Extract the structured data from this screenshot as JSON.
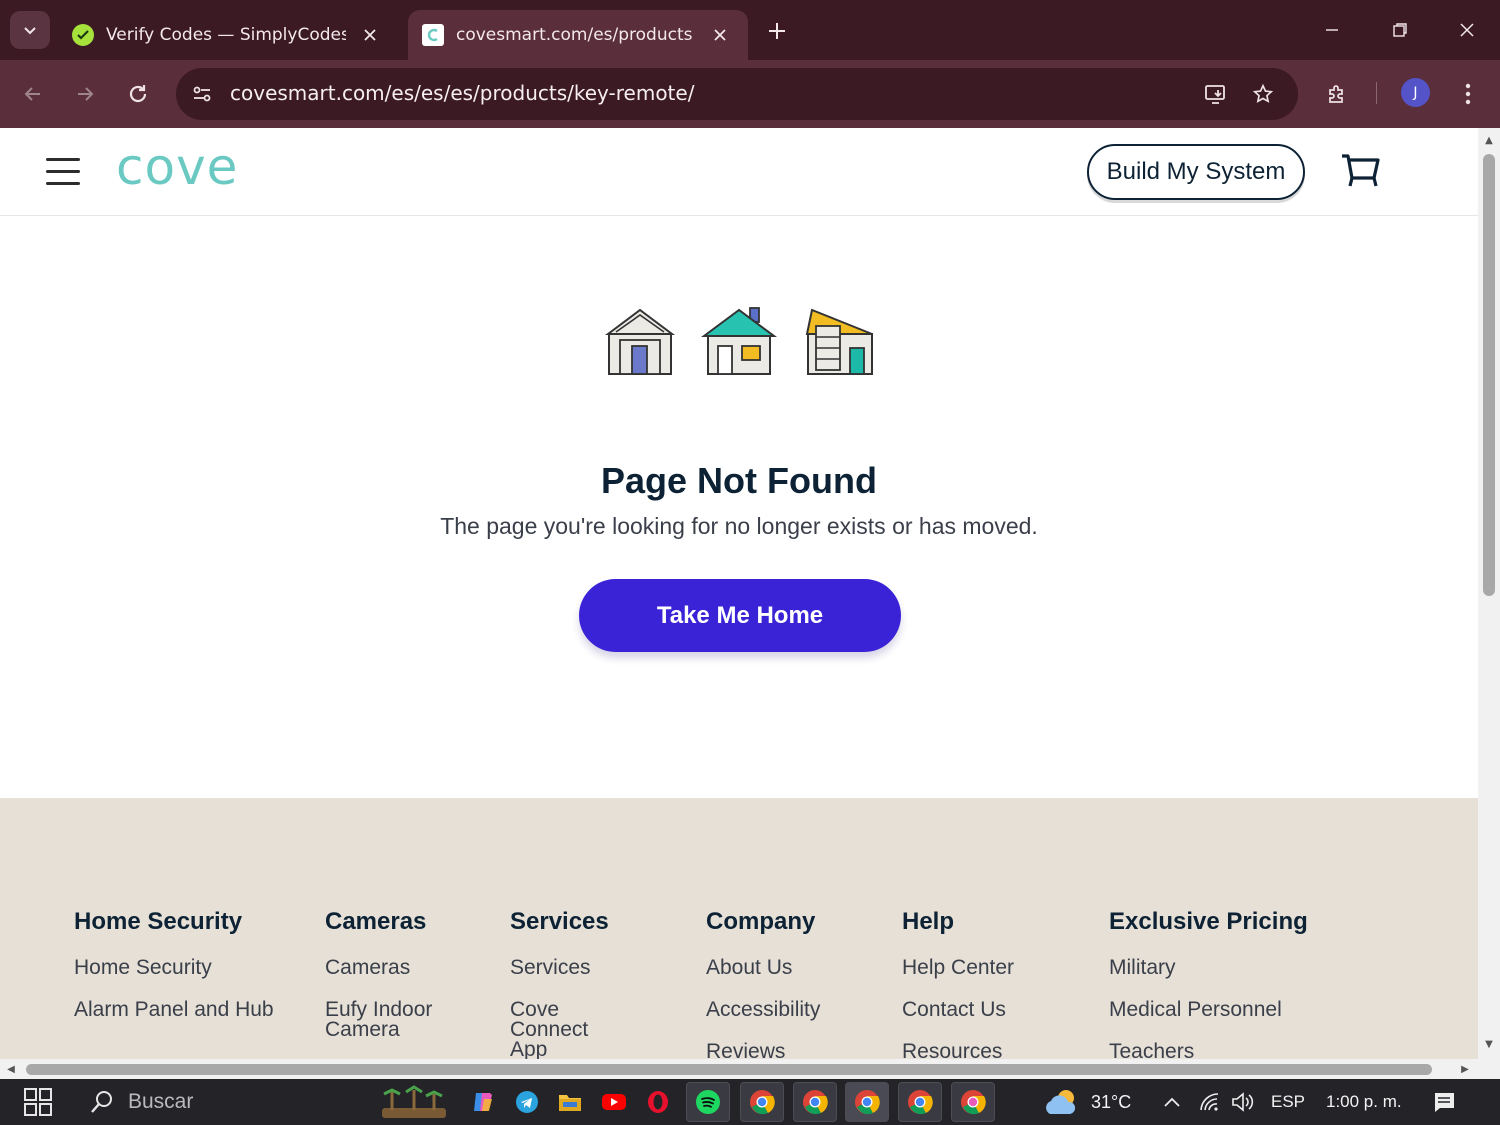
{
  "browser": {
    "tabs": [
      {
        "title": "Verify Codes — SimplyCodes",
        "active": false
      },
      {
        "title": "covesmart.com/es/products/key-remote/",
        "active": true
      }
    ],
    "url": "covesmart.com/es/es/es/products/key-remote/",
    "profile_initial": "J"
  },
  "site": {
    "logo": "cove",
    "build_button": "Build My System"
  },
  "not_found": {
    "title": "Page Not Found",
    "subtitle": "The page you're looking for no longer exists or has moved.",
    "home_button": "Take Me Home"
  },
  "footer": {
    "columns": [
      {
        "heading": "Home Security",
        "links": [
          "Home Security",
          "Alarm Panel and Hub"
        ]
      },
      {
        "heading": "Cameras",
        "links": [
          "Cameras",
          "Eufy Indoor Camera"
        ]
      },
      {
        "heading": "Services",
        "links": [
          "Services",
          "Cove Connect App"
        ]
      },
      {
        "heading": "Company",
        "links": [
          "About Us",
          "Accessibility",
          "Reviews"
        ]
      },
      {
        "heading": "Help",
        "links": [
          "Help Center",
          "Contact Us",
          "Resources"
        ]
      },
      {
        "heading": "Exclusive Pricing",
        "links": [
          "Military",
          "Medical Personnel",
          "Teachers"
        ]
      }
    ]
  },
  "taskbar": {
    "search_label": "Buscar",
    "temperature": "31°C",
    "language": "ESP",
    "time": "1:00 p. m."
  },
  "colors": {
    "chrome_dark": "#3b1a24",
    "chrome_toolbar": "#5a2e3b",
    "brand_teal": "#6ac9c2",
    "primary_button": "#3a23d6",
    "navy_text": "#0d2235",
    "footer_bg": "#e6e0d6"
  }
}
